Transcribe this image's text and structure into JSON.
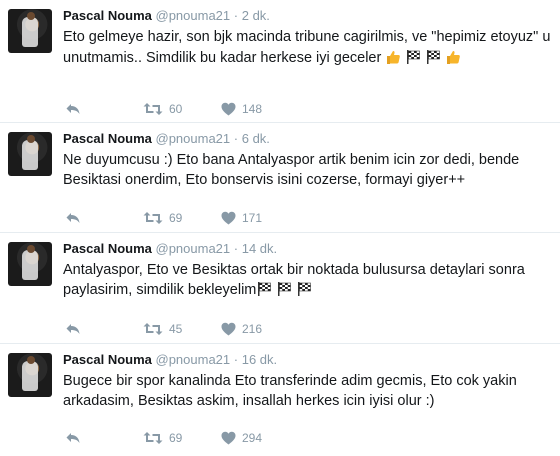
{
  "tweets": [
    {
      "name": "Pascal Nouma",
      "handle": "@pnouma21",
      "sep": "·",
      "time": "2 dk.",
      "text": "Eto gelmeye hazir, son bjk macinda tribune cagirilmis, ve \"hepimiz etoyuz\" u unutmamis.. Simdilik bu kadar herkese iyi geceler",
      "emojis": [
        "thumbs-up",
        "checkered-flag",
        "checkered-flag",
        "thumbs-up"
      ],
      "retweets": "60",
      "likes": "148"
    },
    {
      "name": "Pascal Nouma",
      "handle": "@pnouma21",
      "sep": "·",
      "time": "6 dk.",
      "text": "Ne duyumcusu :) Eto bana Antalyaspor artik benim icin zor dedi, bende Besiktasi onerdim, Eto bonservis isini cozerse, formayi giyer++",
      "emojis": [],
      "retweets": "69",
      "likes": "171"
    },
    {
      "name": "Pascal Nouma",
      "handle": "@pnouma21",
      "sep": "·",
      "time": "14 dk.",
      "text": "Antalyaspor, Eto ve Besiktas ortak bir noktada bulusursa detaylari sonra paylasirim, simdilik bekleyelim",
      "emojis": [
        "checkered-flag",
        "checkered-flag",
        "checkered-flag"
      ],
      "retweets": "45",
      "likes": "216"
    },
    {
      "name": "Pascal Nouma",
      "handle": "@pnouma21",
      "sep": "·",
      "time": "16 dk.",
      "text": "Bugece bir spor kanalinda Eto transferinde adim gecmis, Eto cok yakin arkadasim, Besiktas askim, insallah herkes icin iyisi olur :)",
      "emojis": [],
      "retweets": "69",
      "likes": "294"
    }
  ],
  "icons": {
    "reply": "reply-icon",
    "retweet": "retweet-icon",
    "like": "heart-icon",
    "thumbs": "thumbs-up-icon",
    "flag": "checkered-flag-icon"
  },
  "colors": {
    "text": "#14171a",
    "muted": "#8899a6",
    "divider": "#e6ecf0",
    "thumb": "#f7b52b"
  }
}
